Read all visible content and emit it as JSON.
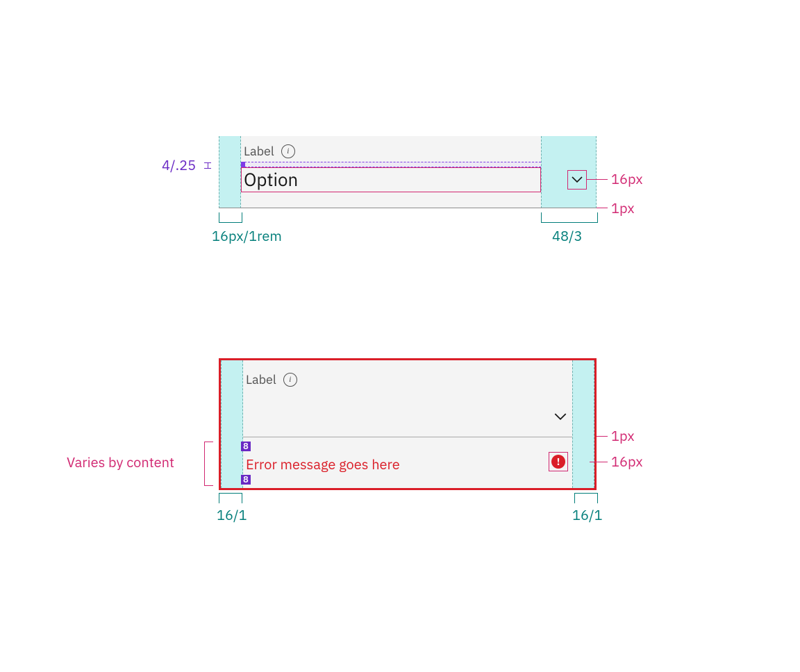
{
  "fig1": {
    "label": "Label",
    "option": "Option",
    "gap_anno": "4/.25",
    "left_pad": "16px/1rem",
    "right_pad": "48/3",
    "chev_size": "16px",
    "rule_size": "1px"
  },
  "fig2": {
    "label": "Label",
    "error": "Error message goes here",
    "left_pad": "16/1",
    "right_pad": "16/1",
    "rule_size": "1px",
    "icon_size": "16px",
    "varies": "Varies by content",
    "spacing_tag": "8"
  }
}
